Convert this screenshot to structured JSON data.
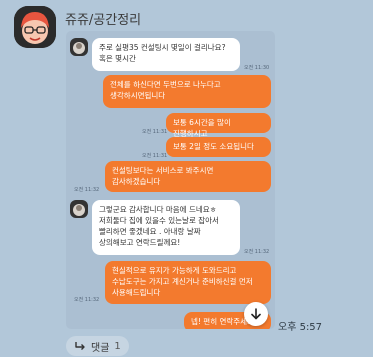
{
  "chat": {
    "sender": "쥬쥬/공간정리",
    "post_time": "오후 5:57"
  },
  "card": {
    "messages": [
      {
        "dir": "in",
        "text": "주로 실평35 컨설팅시 몇일이 걸리나요? 혹은 몇시간",
        "time": "오전 11:30"
      },
      {
        "dir": "out",
        "text": "전체를 하신다면 두번으로 나누다고 생각하시면됩니다",
        "time": ""
      },
      {
        "dir": "out",
        "text": "보통 6시간을 많이 진행하시고",
        "time": "오전 11:31"
      },
      {
        "dir": "out",
        "text": "보통 2일 정도 소요됩니다",
        "time": "오전 11:31"
      },
      {
        "dir": "out",
        "text": "컨설팅보다는 서비스로 봐주시면 감사하겠습니다",
        "time": "오전 11:32"
      },
      {
        "dir": "in",
        "text": "그렇군요 감사합니다 마음에 드네요ㅎ 저희둘다 집에 있을수 있는날로 잡아서 빨리하면 좋겠네요 . 아내랑 날짜 상의해보고 연락드릴께요!",
        "time": "오전 11:32"
      },
      {
        "dir": "out",
        "text": "현실적으로 유지가 가능하게 도와드리고 수납도구는 가지고 계신거나 준비하신걸 먼저 사용해드립니다",
        "time": "오전 11:32"
      },
      {
        "dir": "out",
        "text": "넵! 편히 연락주세요",
        "time": ""
      }
    ]
  },
  "reply": {
    "label": "댓글",
    "count": "1"
  },
  "icons": {
    "scroll_down": "arrow-down-icon",
    "reply": "reply-arrow-icon",
    "avatar": "profile-avatar"
  },
  "colors": {
    "background": "#b2c7d9",
    "outgoing_bubble": "#f37a2e",
    "incoming_bubble": "#ffffff"
  }
}
